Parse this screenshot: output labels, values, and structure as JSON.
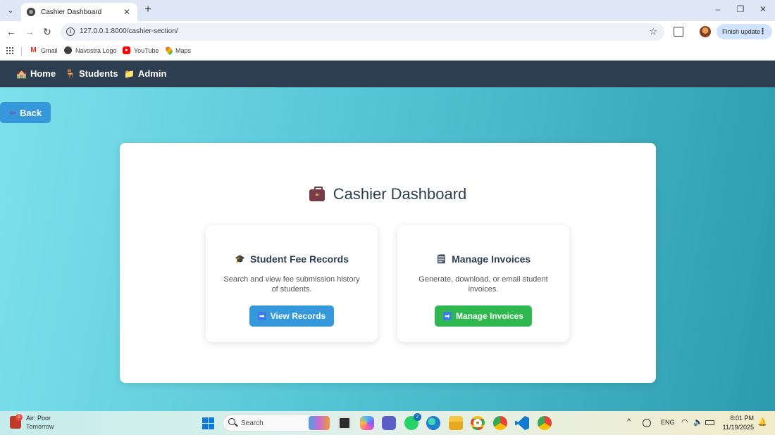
{
  "browser": {
    "tab_title": "Cashier Dashboard",
    "url": "127.0.0.1:8000/cashier-section/",
    "finish_update_label": "Finish update",
    "bookmarks": [
      {
        "label": "Gmail",
        "icon": "gmail-icon"
      },
      {
        "label": "Navostra Logo",
        "icon": "globe-icon"
      },
      {
        "label": "YouTube",
        "icon": "youtube-icon"
      },
      {
        "label": "Maps",
        "icon": "maps-icon"
      }
    ]
  },
  "navbar": {
    "items": [
      {
        "label": "Home",
        "icon": "🏫"
      },
      {
        "label": "Students",
        "icon": "🪑"
      },
      {
        "label": "Admin",
        "icon": "📁"
      }
    ],
    "background": "#2c3e50"
  },
  "back_button": {
    "label": "Back",
    "icon": "⇦"
  },
  "dashboard": {
    "title": "Cashier Dashboard",
    "cards": [
      {
        "title": "Student Fee Records",
        "icon": "🎓",
        "description": "Search and view fee submission history of students.",
        "button_label": "View Records",
        "button_color": "#3498db"
      },
      {
        "title": "Manage Invoices",
        "icon": "🗒",
        "description": "Generate, download, or email student invoices.",
        "button_label": "Manage Invoices",
        "button_color": "#2eb84f"
      }
    ]
  },
  "taskbar": {
    "weather_title": "Air: Poor",
    "weather_sub": "Tomorrow",
    "weather_badge": "1",
    "search_label": "Search",
    "whatsapp_badge": "2",
    "language": "ENG",
    "time": "8:01 PM",
    "date": "11/19/2025"
  },
  "colors": {
    "page_gradient_start": "#7ee1ec",
    "page_gradient_end": "#2d9bae",
    "accent_blue": "#3498db",
    "accent_green": "#2eb84f"
  }
}
